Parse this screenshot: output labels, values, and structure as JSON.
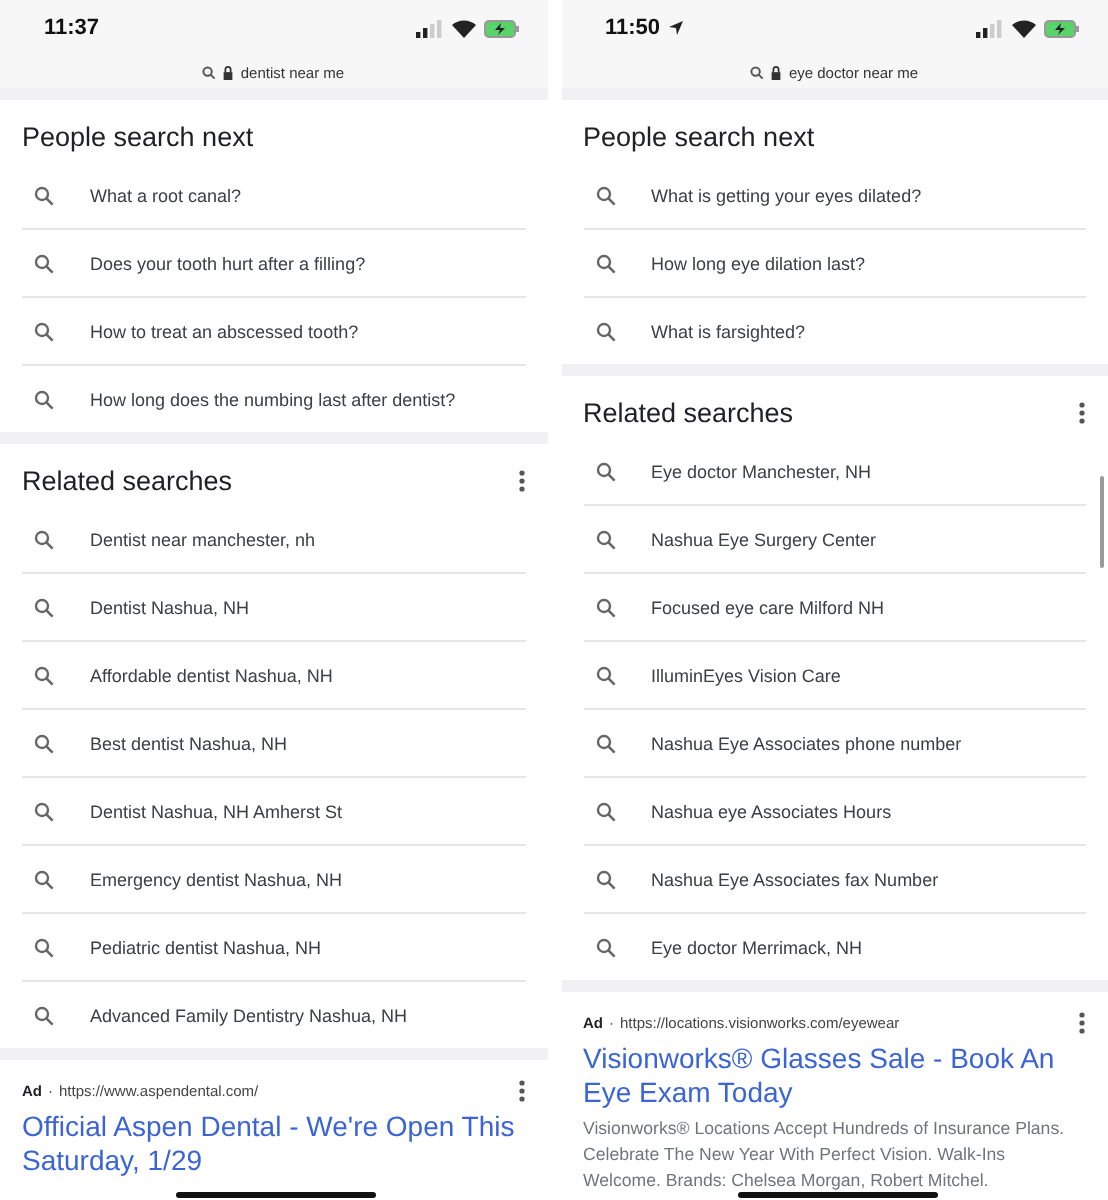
{
  "screens": [
    {
      "status_bar": {
        "time": "11:37",
        "location": false
      },
      "address_bar": {
        "query": "dentist near me"
      },
      "sections": [
        {
          "title": "People search next",
          "menu": false,
          "items": [
            "What a root canal?",
            "Does your tooth hurt after a filling?",
            "How to treat an abscessed tooth?",
            "How long does the numbing last after dentist?"
          ]
        },
        {
          "title": "Related searches",
          "menu": true,
          "items": [
            "Dentist near manchester, nh",
            "Dentist Nashua, NH",
            "Affordable dentist Nashua, NH",
            "Best dentist Nashua, NH",
            "Dentist Nashua, NH Amherst St",
            "Emergency dentist Nashua, NH",
            "Pediatric dentist Nashua, NH",
            "Advanced Family Dentistry Nashua, NH"
          ]
        }
      ],
      "ad": {
        "label": "Ad",
        "separator": "·",
        "url": "https://www.aspendental.com/",
        "title": "Official Aspen Dental - We're Open This Saturday, 1/29"
      }
    },
    {
      "status_bar": {
        "time": "11:50",
        "location": true
      },
      "address_bar": {
        "query": "eye doctor near me"
      },
      "sections": [
        {
          "title": "People search next",
          "menu": false,
          "items": [
            "What is getting your eyes dilated?",
            "How long eye dilation last?",
            "What is farsighted?"
          ]
        },
        {
          "title": "Related searches",
          "menu": true,
          "items": [
            "Eye doctor Manchester, NH",
            "Nashua Eye Surgery Center",
            "Focused eye care Milford NH",
            "IlluminEyes Vision Care",
            "Nashua Eye Associates phone number",
            "Nashua eye Associates Hours",
            "Nashua Eye Associates fax Number",
            "Eye doctor Merrimack, NH"
          ]
        }
      ],
      "ad": {
        "label": "Ad",
        "separator": "·",
        "url": "https://locations.visionworks.com/eyewear",
        "title": "Visionworks® Glasses Sale - Book An Eye Exam Today",
        "description": "Visionworks® Locations Accept Hundreds of Insurance Plans. Celebrate The New Year With Perfect Vision. Walk-Ins Welcome. Brands: Chelsea Morgan, Robert Mitchel."
      }
    }
  ]
}
